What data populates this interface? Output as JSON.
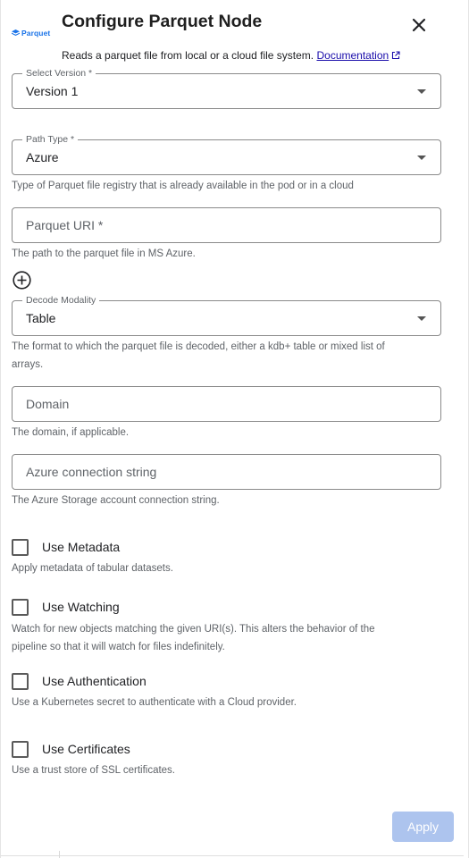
{
  "header": {
    "logo_text": "Parquet",
    "title": "Configure Parquet Node",
    "description": "Reads a parquet file from local or a cloud file system.",
    "doc_link": "Documentation"
  },
  "fields": {
    "version": {
      "label": "Select Version *",
      "value": "Version 1"
    },
    "path_type": {
      "label": "Path Type *",
      "value": "Azure",
      "helper": "Type of Parquet file registry that is already available in the pod or in a cloud"
    },
    "parquet_uri": {
      "placeholder": "Parquet URI *",
      "helper": "The path to the parquet file in MS Azure."
    },
    "decode_modality": {
      "label": "Decode Modality",
      "value": "Table",
      "helper_line1": "The format to which the parquet file is decoded, either a kdb+ table or mixed list of",
      "helper_line2": "arrays."
    },
    "domain": {
      "placeholder": "Domain",
      "helper": "The domain, if applicable."
    },
    "azure_conn": {
      "placeholder": "Azure connection string",
      "helper": "The Azure Storage account connection string."
    }
  },
  "options": {
    "metadata": {
      "label": "Use Metadata",
      "helper": "Apply metadata of tabular datasets.",
      "checked": false
    },
    "watching": {
      "label": "Use Watching",
      "helper_line1": "Watch for new objects matching the given URI(s). This alters the behavior of the",
      "helper_line2": "pipeline so that it will watch for files indefinitely.",
      "checked": false
    },
    "authentication": {
      "label": "Use Authentication",
      "helper": "Use a Kubernetes secret to authenticate with a Cloud provider.",
      "checked": false
    },
    "certificates": {
      "label": "Use Certificates",
      "helper": "Use a trust store of SSL certificates.",
      "checked": false
    }
  },
  "footer": {
    "apply_label": "Apply"
  },
  "colors": {
    "link": "#1a0dab",
    "apply_disabled": "#adc4ee",
    "logo": "#1a73e8"
  },
  "icons": [
    "parquet-logo-icon",
    "close-icon",
    "external-link-icon",
    "add-circle-icon",
    "dropdown-caret-icon"
  ]
}
